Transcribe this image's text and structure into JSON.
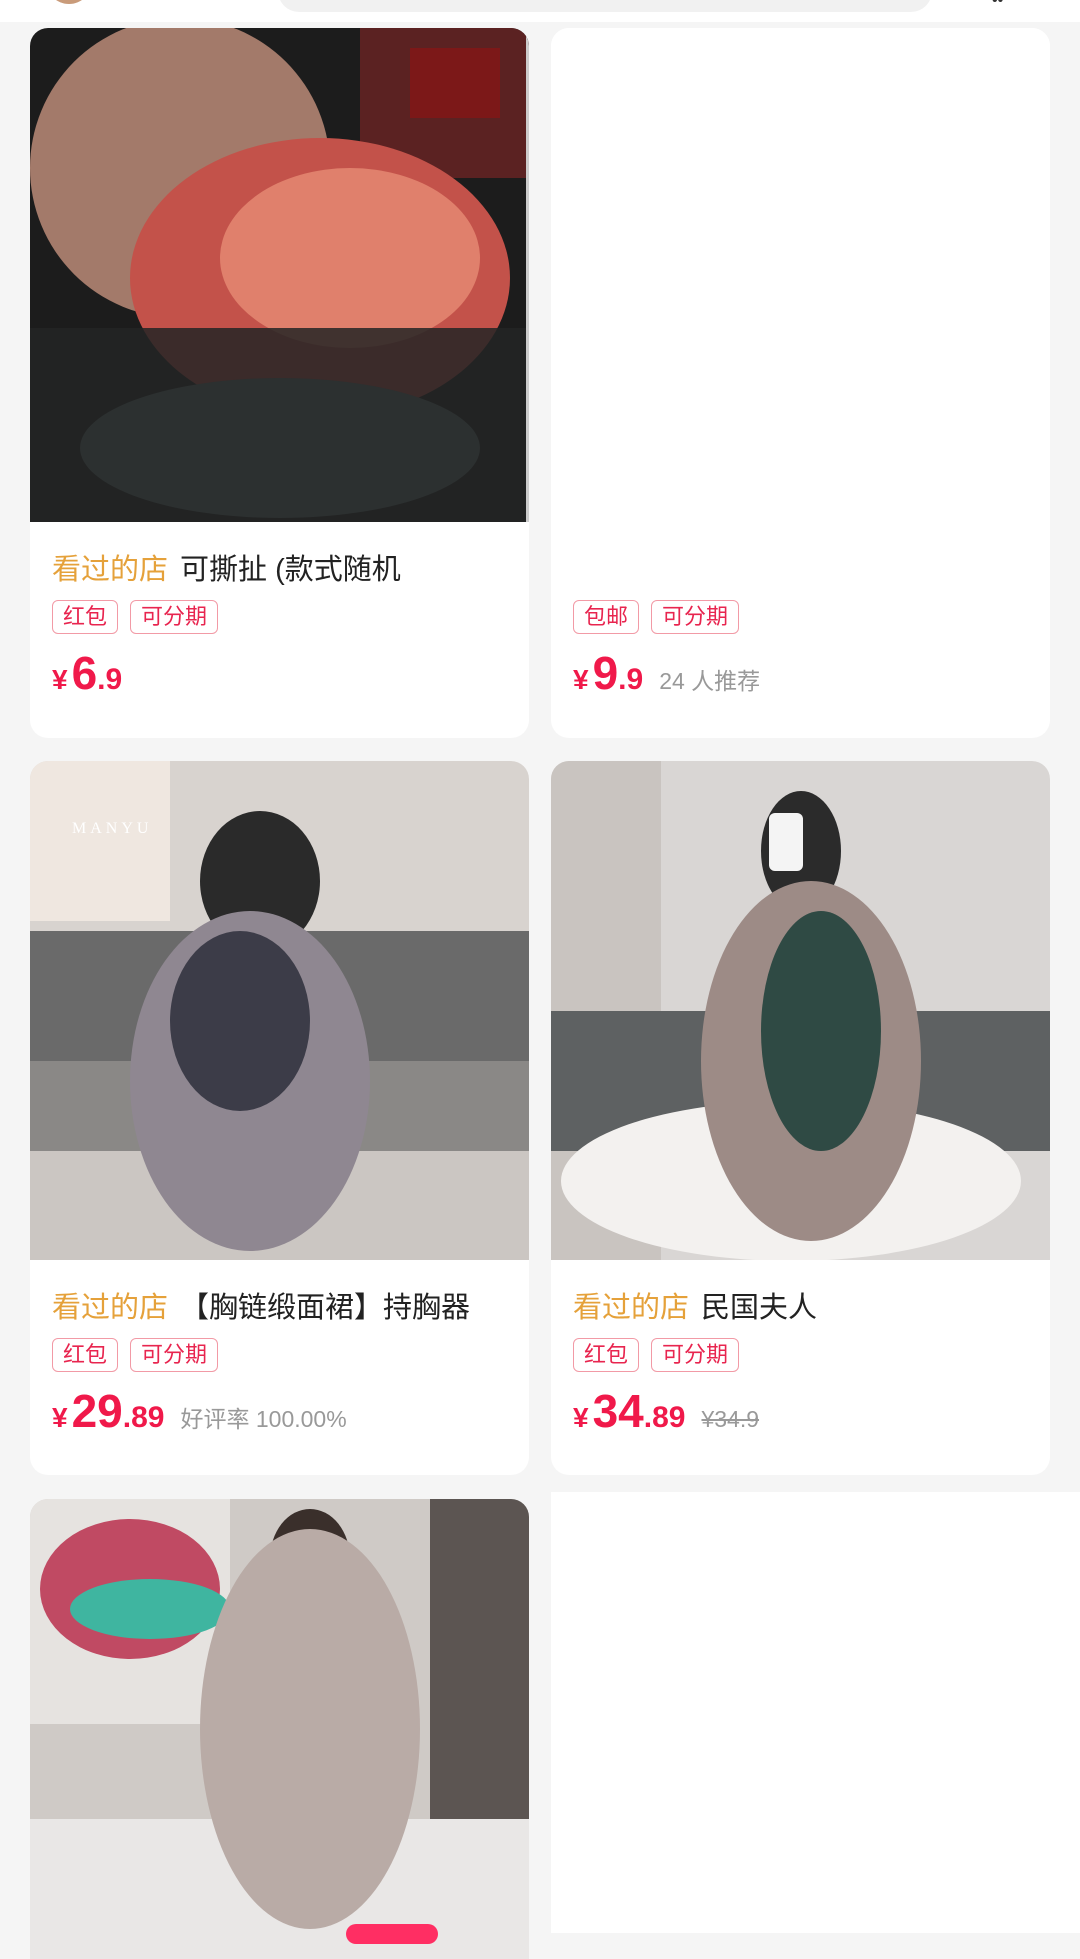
{
  "feed": {
    "items": [
      {
        "seen_label": "看过的店",
        "title": "可撕扯 (款式随机",
        "tags": [
          "红包",
          "可分期"
        ],
        "price_yen": "¥",
        "price_int": "6",
        "price_dec": ".9",
        "extra": "",
        "orig": ""
      },
      {
        "seen_label": "",
        "title": "",
        "tags": [
          "包邮",
          "可分期"
        ],
        "price_yen": "¥",
        "price_int": "9",
        "price_dec": ".9",
        "extra": "24 人推荐",
        "orig": ""
      },
      {
        "seen_label": "看过的店",
        "title": "【胸链缎面裙】持胸器",
        "tags": [
          "红包",
          "可分期"
        ],
        "price_yen": "¥",
        "price_int": "29",
        "price_dec": ".89",
        "extra": "好评率 100.00%",
        "orig": "",
        "watermark": "MANYU"
      },
      {
        "seen_label": "看过的店",
        "title": "民国夫人",
        "tags": [
          "红包",
          "可分期"
        ],
        "price_yen": "¥",
        "price_int": "34",
        "price_dec": ".89",
        "extra": "",
        "orig": "¥34.9"
      }
    ]
  },
  "colors": {
    "price": "#f0194a",
    "seen": "#e5a13a",
    "tag_border": "#f29aa6",
    "accent": "#ff2e63"
  },
  "icons": {
    "top_right": "more-icon"
  }
}
